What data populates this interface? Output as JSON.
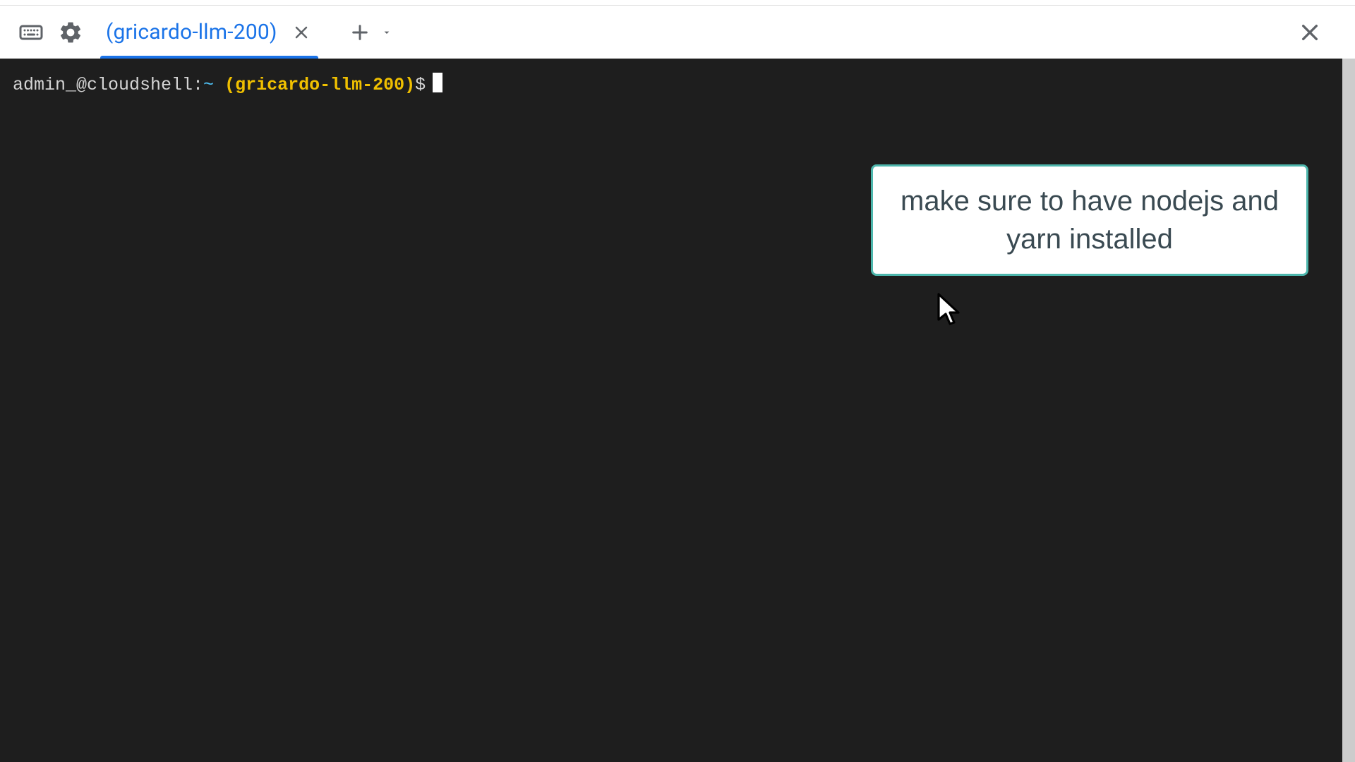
{
  "toolbar": {
    "keyboard_icon": "keyboard-icon",
    "settings_icon": "gear-icon",
    "add_icon": "plus-icon",
    "dropdown_icon": "dropdown-icon",
    "close_icon": "close-icon"
  },
  "tab": {
    "label": "(gricardo-llm-200)",
    "close_icon": "close-icon"
  },
  "terminal": {
    "prompt_user": "admin_@cloudshell:",
    "prompt_tilde": "~",
    "prompt_project": "(gricardo-llm-200)",
    "prompt_symbol": "$"
  },
  "annotation": {
    "text": "make sure to have nodejs and yarn installed"
  }
}
